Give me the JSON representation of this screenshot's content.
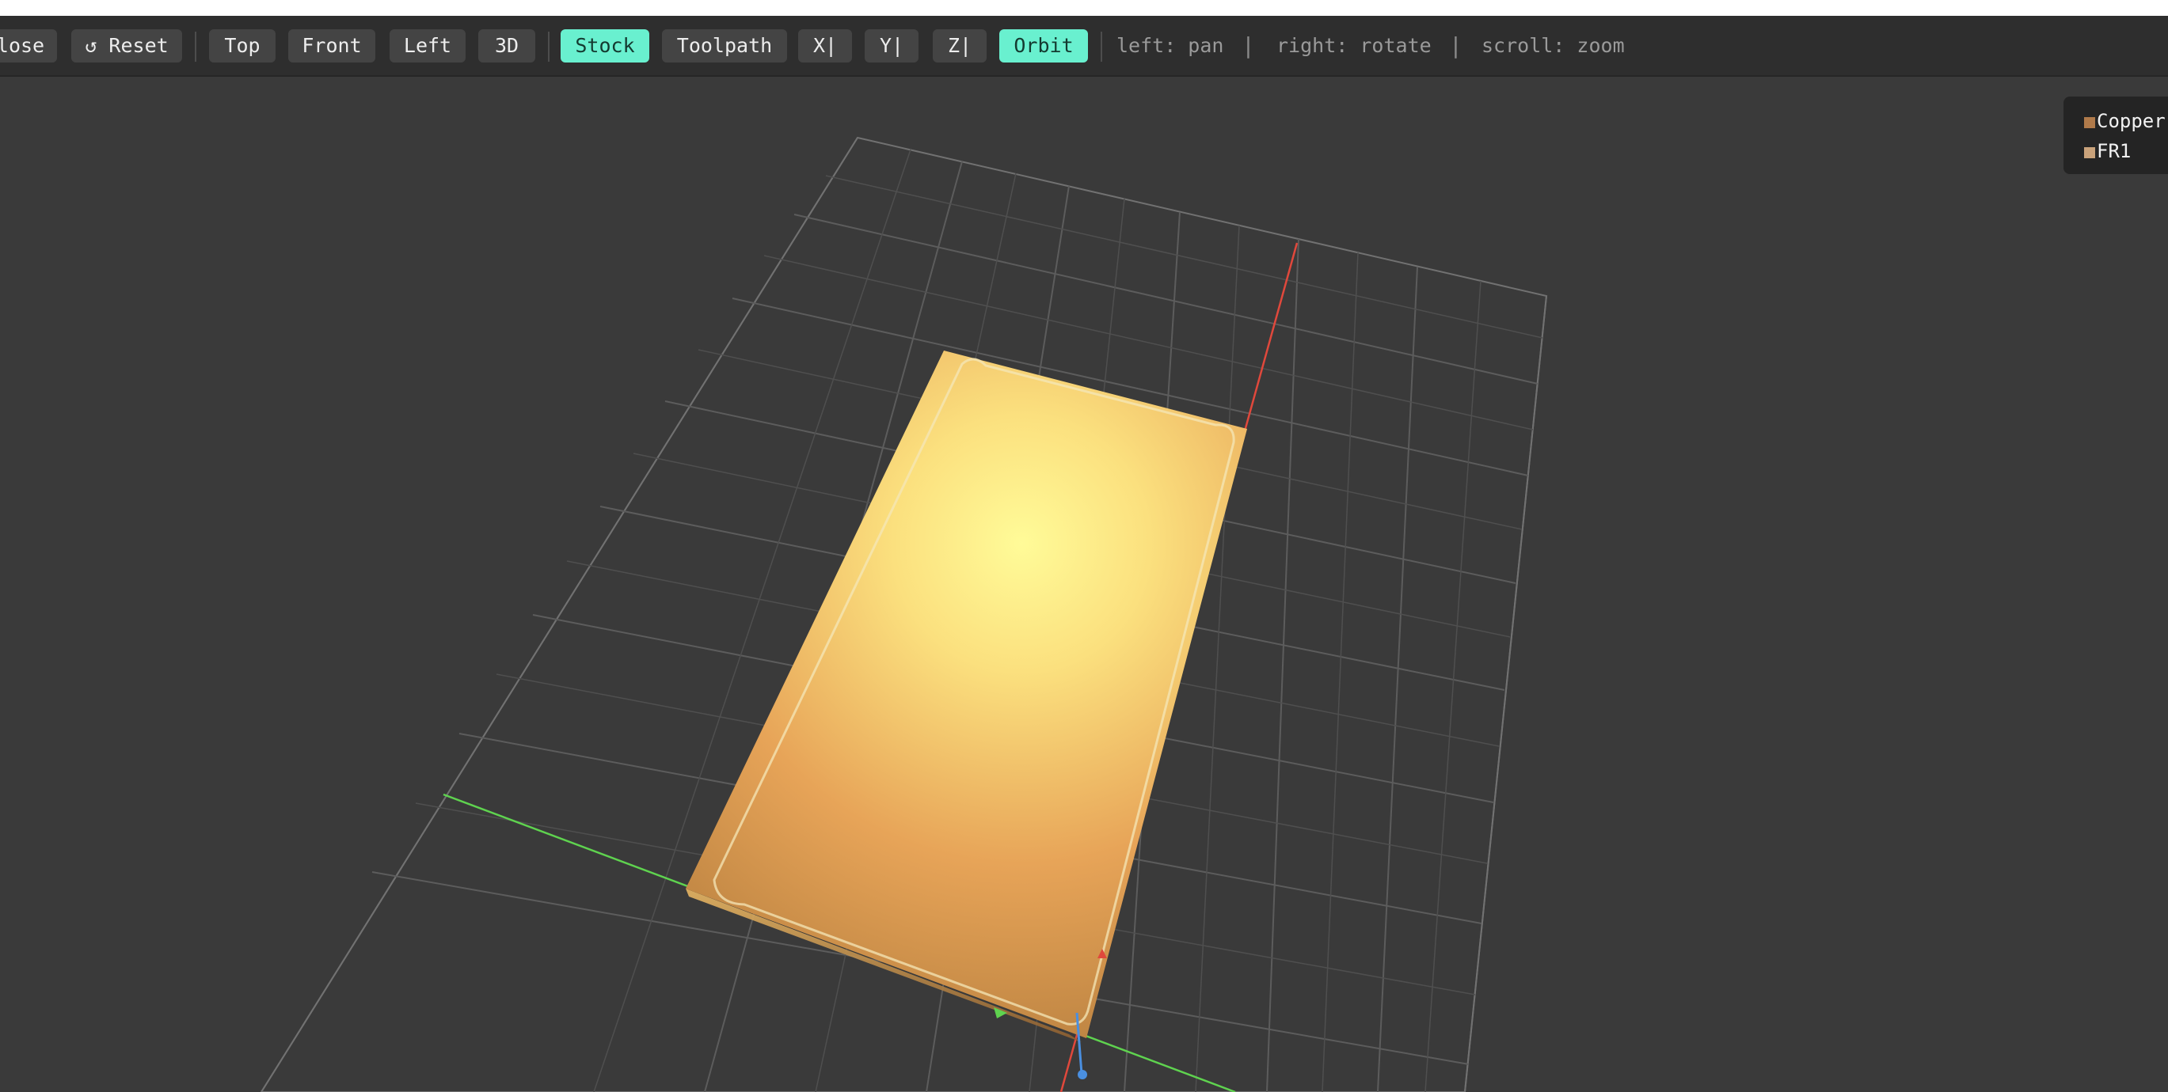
{
  "toolbar": {
    "close_label": "lose",
    "reset_label": "↺ Reset",
    "views": [
      "Top",
      "Front",
      "Left",
      "3D"
    ],
    "stock_label": "Stock",
    "toolpath_label": "Toolpath",
    "axes": [
      "X|",
      "Y|",
      "Z|"
    ],
    "orbit_label": "Orbit",
    "hints": [
      "left: pan",
      "right: rotate",
      "scroll: zoom"
    ],
    "hint_separator": "|",
    "active_color": "#69f0cf"
  },
  "legend": {
    "items": [
      {
        "label": "Copper",
        "color": "#b07a4a"
      },
      {
        "label": "FR1",
        "color": "#c9a27a"
      }
    ]
  },
  "scene": {
    "axis_x_color": "#e0483c",
    "axis_y_color": "#5fd34f",
    "axis_z_color": "#4a8fe0",
    "grid_color": "#7a7a7a",
    "board_highlight": "#fff79a",
    "board_base": "#9a6a38"
  }
}
